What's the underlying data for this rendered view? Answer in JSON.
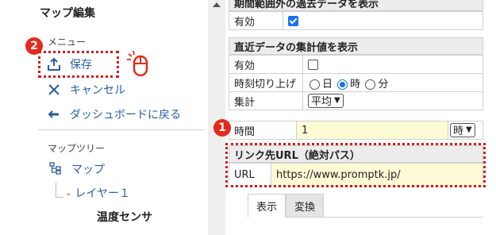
{
  "sidebar": {
    "title": "マップ編集",
    "menu_section": "メニュー",
    "menu_items": [
      {
        "label": "保存",
        "icon": "upload-icon"
      },
      {
        "label": "キャンセル",
        "icon": "close-icon"
      },
      {
        "label": "ダッシュボードに戻る",
        "icon": "back-arrow-icon"
      }
    ],
    "tree_section": "マップツリー",
    "tree": {
      "root": "マップ",
      "layer": "レイヤー１",
      "sensor": "温度センサ"
    }
  },
  "annotations": {
    "badge_1": "1",
    "badge_2": "2",
    "color": "#e32b1d"
  },
  "panel": {
    "past_data_header": "期間範囲外の過去データを表示",
    "past_data_enabled_label": "有効",
    "past_data_enabled": true,
    "aggregate_header": "直近データの集計値を表示",
    "aggregate_enabled_label": "有効",
    "aggregate_enabled": false,
    "round_label": "時刻切り上げ",
    "round_options": [
      "日",
      "時",
      "分"
    ],
    "round_selected": "時",
    "aggregate_label": "集計",
    "aggregate_value": "平均",
    "time_label": "時間",
    "time_value": "1",
    "time_unit": "時",
    "link_header": "リンク先URL（絶対パス）",
    "url_label": "URL",
    "url_value": "https://www.promptk.jp/",
    "tabs": [
      "表示",
      "変換"
    ]
  }
}
